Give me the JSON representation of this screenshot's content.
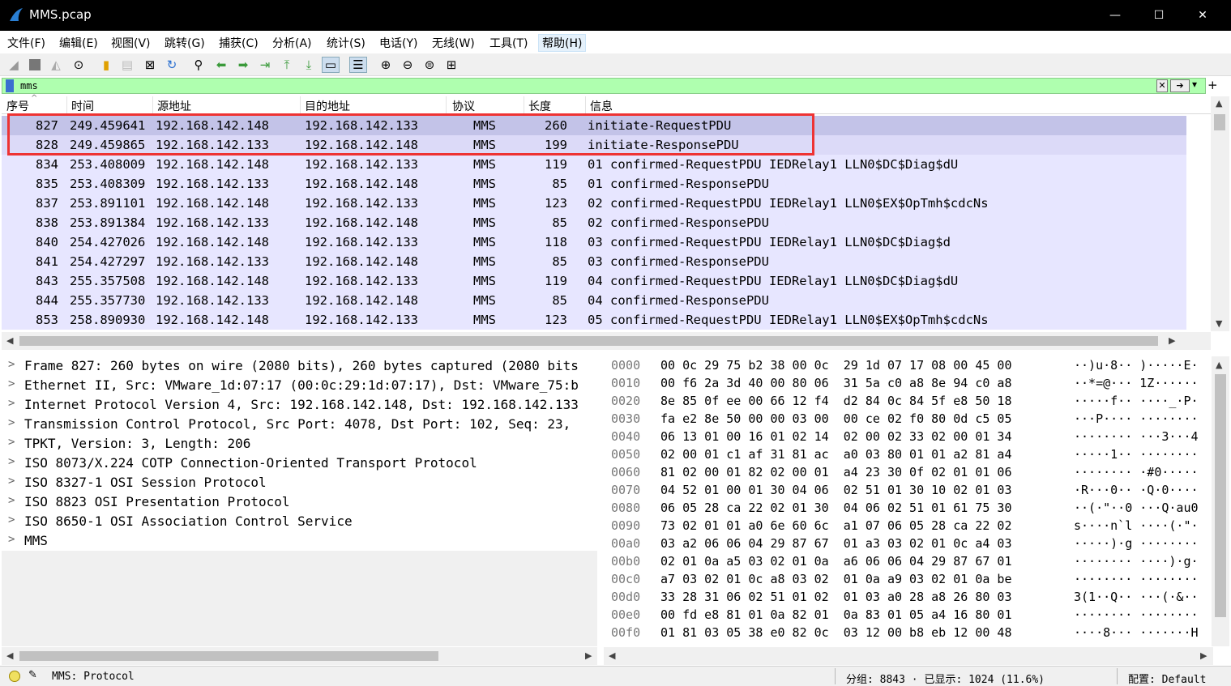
{
  "window": {
    "title": "MMS.pcap",
    "minimize": "—",
    "maximize": "☐",
    "close": "✕"
  },
  "menu": [
    "文件(F)",
    "编辑(E)",
    "视图(V)",
    "跳转(G)",
    "捕获(C)",
    "分析(A)",
    "统计(S)",
    "电话(Y)",
    "无线(W)",
    "工具(T)",
    "帮助(H)"
  ],
  "filter": {
    "value": "mms",
    "clear_icon": "✕",
    "apply_icon": "➔",
    "dropdown_icon": "▾",
    "add_icon": "+"
  },
  "columns": [
    "序号",
    "时间",
    "源地址",
    "目的地址",
    "协议",
    "长度",
    "信息"
  ],
  "packets": [
    {
      "no": "827",
      "time": "249.459641",
      "src": "192.168.142.148",
      "dst": "192.168.142.133",
      "proto": "MMS",
      "len": "260",
      "info": "initiate-RequestPDU"
    },
    {
      "no": "828",
      "time": "249.459865",
      "src": "192.168.142.133",
      "dst": "192.168.142.148",
      "proto": "MMS",
      "len": "199",
      "info": "initiate-ResponsePDU"
    },
    {
      "no": "834",
      "time": "253.408009",
      "src": "192.168.142.148",
      "dst": "192.168.142.133",
      "proto": "MMS",
      "len": "119",
      "info": "01 confirmed-RequestPDU IEDRelay1 LLN0$DC$Diag$dU"
    },
    {
      "no": "835",
      "time": "253.408309",
      "src": "192.168.142.133",
      "dst": "192.168.142.148",
      "proto": "MMS",
      "len": "85",
      "info": "01 confirmed-ResponsePDU"
    },
    {
      "no": "837",
      "time": "253.891101",
      "src": "192.168.142.148",
      "dst": "192.168.142.133",
      "proto": "MMS",
      "len": "123",
      "info": "02 confirmed-RequestPDU IEDRelay1 LLN0$EX$OpTmh$cdcNs"
    },
    {
      "no": "838",
      "time": "253.891384",
      "src": "192.168.142.133",
      "dst": "192.168.142.148",
      "proto": "MMS",
      "len": "85",
      "info": "02 confirmed-ResponsePDU"
    },
    {
      "no": "840",
      "time": "254.427026",
      "src": "192.168.142.148",
      "dst": "192.168.142.133",
      "proto": "MMS",
      "len": "118",
      "info": "03 confirmed-RequestPDU IEDRelay1 LLN0$DC$Diag$d"
    },
    {
      "no": "841",
      "time": "254.427297",
      "src": "192.168.142.133",
      "dst": "192.168.142.148",
      "proto": "MMS",
      "len": "85",
      "info": "03 confirmed-ResponsePDU"
    },
    {
      "no": "843",
      "time": "255.357508",
      "src": "192.168.142.148",
      "dst": "192.168.142.133",
      "proto": "MMS",
      "len": "119",
      "info": "04 confirmed-RequestPDU IEDRelay1 LLN0$DC$Diag$dU"
    },
    {
      "no": "844",
      "time": "255.357730",
      "src": "192.168.142.133",
      "dst": "192.168.142.148",
      "proto": "MMS",
      "len": "85",
      "info": "04 confirmed-ResponsePDU"
    },
    {
      "no": "853",
      "time": "258.890930",
      "src": "192.168.142.148",
      "dst": "192.168.142.133",
      "proto": "MMS",
      "len": "123",
      "info": "05 confirmed-RequestPDU IEDRelay1 LLN0$EX$OpTmh$cdcNs"
    }
  ],
  "details": [
    "Frame 827: 260 bytes on wire (2080 bits), 260 bytes captured (2080 bits",
    "Ethernet II, Src: VMware_1d:07:17 (00:0c:29:1d:07:17), Dst: VMware_75:b",
    "Internet Protocol Version 4, Src: 192.168.142.148, Dst: 192.168.142.133",
    "Transmission Control Protocol, Src Port: 4078, Dst Port: 102, Seq: 23,",
    "TPKT, Version: 3, Length: 206",
    "ISO 8073/X.224 COTP Connection-Oriented Transport Protocol",
    "ISO 8327-1 OSI Session Protocol",
    "ISO 8823 OSI Presentation Protocol",
    "ISO 8650-1 OSI Association Control Service",
    "MMS"
  ],
  "bytes": [
    {
      "off": "0000",
      "hex": "00 0c 29 75 b2 38 00 0c  29 1d 07 17 08 00 45 00",
      "ascii": "··)u·8·· )·····E·"
    },
    {
      "off": "0010",
      "hex": "00 f6 2a 3d 40 00 80 06  31 5a c0 a8 8e 94 c0 a8",
      "ascii": "··*=@··· 1Z······"
    },
    {
      "off": "0020",
      "hex": "8e 85 0f ee 00 66 12 f4  d2 84 0c 84 5f e8 50 18",
      "ascii": "·····f·· ····_·P·"
    },
    {
      "off": "0030",
      "hex": "fa e2 8e 50 00 00 03 00  00 ce 02 f0 80 0d c5 05",
      "ascii": "···P···· ········"
    },
    {
      "off": "0040",
      "hex": "06 13 01 00 16 01 02 14  02 00 02 33 02 00 01 34",
      "ascii": "········ ···3···4"
    },
    {
      "off": "0050",
      "hex": "02 00 01 c1 af 31 81 ac  a0 03 80 01 01 a2 81 a4",
      "ascii": "·····1·· ········"
    },
    {
      "off": "0060",
      "hex": "81 02 00 01 82 02 00 01  a4 23 30 0f 02 01 01 06",
      "ascii": "········ ·#0·····"
    },
    {
      "off": "0070",
      "hex": "04 52 01 00 01 30 04 06  02 51 01 30 10 02 01 03",
      "ascii": "·R···0·· ·Q·0····"
    },
    {
      "off": "0080",
      "hex": "06 05 28 ca 22 02 01 30  04 06 02 51 01 61 75 30",
      "ascii": "··(·\"··0 ···Q·au0"
    },
    {
      "off": "0090",
      "hex": "73 02 01 01 a0 6e 60 6c  a1 07 06 05 28 ca 22 02",
      "ascii": "s····n`l ····(·\"·"
    },
    {
      "off": "00a0",
      "hex": "03 a2 06 06 04 29 87 67  01 a3 03 02 01 0c a4 03",
      "ascii": "·····)·g ········"
    },
    {
      "off": "00b0",
      "hex": "02 01 0a a5 03 02 01 0a  a6 06 06 04 29 87 67 01",
      "ascii": "········ ····)·g·"
    },
    {
      "off": "00c0",
      "hex": "a7 03 02 01 0c a8 03 02  01 0a a9 03 02 01 0a be",
      "ascii": "········ ········"
    },
    {
      "off": "00d0",
      "hex": "33 28 31 06 02 51 01 02  01 03 a0 28 a8 26 80 03",
      "ascii": "3(1··Q·· ···(·&··"
    },
    {
      "off": "00e0",
      "hex": "00 fd e8 81 01 0a 82 01  0a 83 01 05 a4 16 80 01",
      "ascii": "········ ········"
    },
    {
      "off": "00f0",
      "hex": "01 81 03 05 38 e0 82 0c  03 12 00 b8 eb 12 00 48",
      "ascii": "····8··· ·······H"
    }
  ],
  "status": {
    "text": "MMS: Protocol",
    "packets": "分组: 8843 · 已显示: 1024 (11.6%)",
    "profile": "配置: Default"
  }
}
